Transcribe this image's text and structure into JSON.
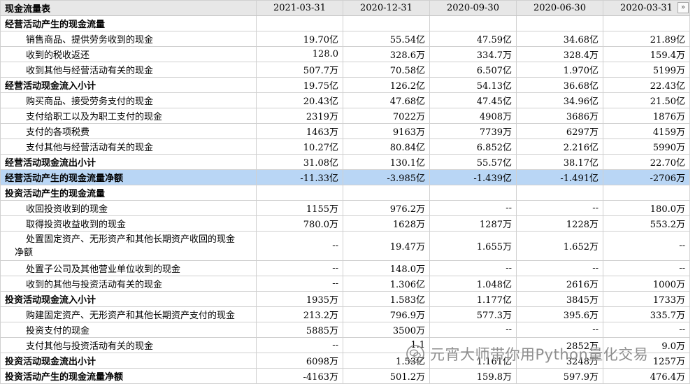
{
  "header": {
    "title": "现金流量表",
    "dates": [
      "2021-03-31",
      "2020-12-31",
      "2020-09-30",
      "2020-06-30",
      "2020-03-31"
    ],
    "expand_glyph": "»"
  },
  "rows": [
    {
      "type": "section",
      "label": "经营活动产生的现金流量",
      "values": [
        "",
        "",
        "",
        "",
        ""
      ]
    },
    {
      "type": "item",
      "label": "销售商品、提供劳务收到的现金",
      "values": [
        "19.70亿",
        "55.54亿",
        "47.59亿",
        "34.68亿",
        "21.89亿"
      ]
    },
    {
      "type": "item",
      "label": "收到的税收返还",
      "values": [
        "128.0",
        "328.6万",
        "334.7万",
        "328.4万",
        "159.4万"
      ]
    },
    {
      "type": "item",
      "label": "收到其他与经营活动有关的现金",
      "values": [
        "507.7万",
        "70.58亿",
        "6.507亿",
        "1.970亿",
        "5199万"
      ]
    },
    {
      "type": "subtotal",
      "label": "经营活动现金流入小计",
      "values": [
        "19.75亿",
        "126.2亿",
        "54.13亿",
        "36.68亿",
        "22.43亿"
      ]
    },
    {
      "type": "item",
      "label": "购买商品、接受劳务支付的现金",
      "values": [
        "20.43亿",
        "47.68亿",
        "47.45亿",
        "34.96亿",
        "21.50亿"
      ]
    },
    {
      "type": "item",
      "label": "支付给职工以及为职工支付的现金",
      "values": [
        "2319万",
        "7022万",
        "4908万",
        "3686万",
        "1876万"
      ]
    },
    {
      "type": "item",
      "label": "支付的各项税费",
      "values": [
        "1463万",
        "9163万",
        "7739万",
        "6297万",
        "4159万"
      ]
    },
    {
      "type": "item",
      "label": "支付其他与经营活动有关的现金",
      "values": [
        "10.27亿",
        "80.84亿",
        "6.852亿",
        "2.216亿",
        "5990万"
      ]
    },
    {
      "type": "subtotal",
      "label": "经营活动现金流出小计",
      "values": [
        "31.08亿",
        "130.1亿",
        "55.57亿",
        "38.17亿",
        "22.70亿"
      ]
    },
    {
      "type": "subtotal",
      "highlight": true,
      "label": "经营活动产生的现金流量净额",
      "values": [
        "-11.33亿",
        "-3.985亿",
        "-1.439亿",
        "-1.491亿",
        "-2706万"
      ]
    },
    {
      "type": "section",
      "label": "投资活动产生的现金流量",
      "values": [
        "",
        "",
        "",
        "",
        ""
      ]
    },
    {
      "type": "item",
      "label": "收回投资收到的现金",
      "values": [
        "1155万",
        "976.2万",
        "--",
        "--",
        "180.0万"
      ]
    },
    {
      "type": "item",
      "label": "取得投资收益收到的现金",
      "values": [
        "780.0万",
        "1628万",
        "1287万",
        "1228万",
        "553.2万"
      ]
    },
    {
      "type": "wrap",
      "label": "处置固定资产、无形资产和其他长期资产收回的现金",
      "label_cont": "净额",
      "values": [
        "--",
        "19.47万",
        "1.655万",
        "1.652万",
        "--"
      ]
    },
    {
      "type": "item",
      "label": "处置子公司及其他营业单位收到的现金",
      "values": [
        "--",
        "148.0万",
        "--",
        "--",
        "--"
      ]
    },
    {
      "type": "item",
      "label": "收到的其他与投资活动有关的现金",
      "values": [
        "--",
        "1.306亿",
        "1.048亿",
        "2616万",
        "1000万"
      ]
    },
    {
      "type": "subtotal",
      "label": "投资活动现金流入小计",
      "values": [
        "1935万",
        "1.583亿",
        "1.177亿",
        "3845万",
        "1733万"
      ]
    },
    {
      "type": "item",
      "label": "购建固定资产、无形资产和其他长期资产支付的现金",
      "values": [
        "213.2万",
        "796.9万",
        "577.3万",
        "395.6万",
        "335.7万"
      ]
    },
    {
      "type": "item",
      "label": "投资支付的现金",
      "values": [
        "5885万",
        "3500万",
        "--",
        "--",
        "--"
      ]
    },
    {
      "type": "item",
      "label": "支付其他与投资活动有关的现金",
      "values": [
        "--",
        "1.1",
        "",
        "2852万",
        "9.0万"
      ]
    },
    {
      "type": "subtotal",
      "label": "投资活动现金流出小计",
      "values": [
        "6098万",
        "1.53亿",
        "1.161亿",
        "3248万",
        "1257万"
      ]
    },
    {
      "type": "subtotal",
      "label": "投资活动产生的现金流量净额",
      "values": [
        "-4163万",
        "501.2万",
        "159.8万",
        "597.9万",
        "476.4万"
      ]
    }
  ],
  "watermark": {
    "text": "元宵大师带你用Python量化交易",
    "icon": "wechat-icon"
  },
  "colors": {
    "header_bg": "#e7e7e7",
    "highlight_bg": "#b9d6f5",
    "grid": "#d0d0d0"
  }
}
